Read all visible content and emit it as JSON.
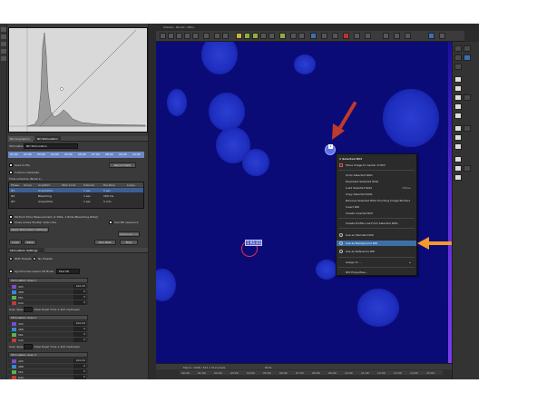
{
  "window": {
    "title": "Volume - Nuclei - NIS.s"
  },
  "left_panel": {
    "tabs": [
      "ND Acquisition",
      "ND Stimulation"
    ],
    "stimulation_label": "Stimulation",
    "stimulation_value": "ND Stimulation",
    "timeline_ticks": [
      "01:00",
      "02:00",
      "03:00",
      "04:00",
      "05:00",
      "06:00",
      "07:00",
      "08:00",
      "09:00",
      "10:00"
    ],
    "save_to_file": "Save to file",
    "record_data": "Record Data",
    "custom_metadata": "Custom metadata",
    "time_schedule": "Time schedule (Node 1)",
    "table_headers": [
      "Phase",
      "Group",
      "Acq/Stim",
      "Stim Cont.",
      "Interval",
      "Duration",
      "Loops"
    ],
    "table_rows": [
      [
        "#1",
        "Acquisition",
        "",
        "1 sec",
        "",
        "5 sec"
      ],
      [
        "#2",
        "Bleaching",
        "",
        "1 sec",
        "",
        "200 ms"
      ],
      [
        "#3",
        "Acquisition",
        "",
        "1 sec",
        "",
        "5 min"
      ]
    ],
    "perform_time_measurement": "Perform Time Measurement (1 ROIs, 1 ROIs (Bleaching ROIs))",
    "close_active_shutter": "Close Active Shutter when idle",
    "use_nd_sequence": "Use ND sequence",
    "apply_stimulation": "Apply Stimulation Settings",
    "advanced": "Advanced >>",
    "load": "Load",
    "save": "Save",
    "run_now": "Run Now",
    "stop": "Stop",
    "stimulation_settings": "Stimulation Settings",
    "with_presets": "With Presets",
    "no_presets": "No Presets",
    "synchronize_lasers": "Synchronize Lasers",
    "sp_mode": "SP Mode",
    "sp_mode_value": "Fast SD",
    "areas": [
      {
        "title": "Stimulation Area 1",
        "rows": [
          [
            "405",
            "100.00"
          ],
          [
            "488",
            "0"
          ],
          [
            "561",
            "0"
          ],
          [
            "640",
            "0"
          ]
        ],
        "scan_speed": "Scan Speed",
        "pixel_dwell": "Pixel Dwell Time 1.403 ms/lineLin"
      },
      {
        "title": "Stimulation Area 2",
        "rows": [
          [
            "405",
            "100.00"
          ],
          [
            "488",
            "0"
          ],
          [
            "561",
            "0"
          ],
          [
            "640",
            "0"
          ]
        ],
        "scan_speed": "Scan Speed",
        "pixel_dwell": "Pixel Dwell Time 1.403 ms/lineLin"
      },
      {
        "title": "Stimulation Area 3",
        "rows": [
          [
            "405",
            "100.00"
          ],
          [
            "488",
            "0"
          ],
          [
            "561",
            "0"
          ],
          [
            "640",
            "0"
          ]
        ],
        "scan_speed": "Scan Speed",
        "pixel_dwell": "Pixel Dwell Time 1.403 ms/lineLin"
      }
    ],
    "roi_approach": "Manual ROI Approach"
  },
  "canvas": {
    "roi_selected_label": "1",
    "roi_label": "1 R1 E1"
  },
  "context_menu": {
    "header": "1 Selected ROI",
    "items": [
      {
        "label": "Move Image to Center of ROI",
        "icon": "move-icon"
      },
      {
        "label": "Undo Selected ROIs",
        "icon": ""
      },
      {
        "label": "Duplicate Selected ROIs",
        "icon": ""
      },
      {
        "label": "Load Selected ROIs",
        "icon": "",
        "shortcut": "Ctrl+L"
      },
      {
        "label": "Copy Selected ROIs",
        "icon": ""
      },
      {
        "label": "Remove Selected ROIs Touching Image Borders",
        "icon": ""
      },
      {
        "label": "Invert ROI",
        "icon": ""
      },
      {
        "label": "Create Inverted ROI",
        "icon": ""
      },
      {
        "label": "Create Profile Line From Selected ROIs",
        "icon": ""
      },
      {
        "label": "Use as Standard ROI",
        "icon": "roi-standard-icon"
      },
      {
        "label": "Use as Background ROI",
        "icon": "roi-background-icon",
        "highlight": true
      },
      {
        "label": "Use as Reference ROI",
        "icon": "roi-reference-icon"
      },
      {
        "label": "Assign to ...",
        "icon": "",
        "submenu": true
      },
      {
        "label": "ROI Properties...",
        "icon": ""
      }
    ]
  },
  "bottom": {
    "info": "Macro: 1096 / 512 x 512 pixels",
    "scale": "Parfs",
    "timeline_labels": [
      "00:00",
      "01:00",
      "02:00",
      "03:00",
      "04:00",
      "05:00",
      "06:00",
      "07:00",
      "08:00",
      "09:00",
      "10:00",
      "11:00",
      "12:00",
      "13:00",
      "14:00",
      "15:00"
    ],
    "status": "0x1296 / 512 x 512 pixels"
  },
  "colors": {
    "canvas": "#0b0b78",
    "cell": "#1f2fc0",
    "arrow_red": "#c0392b",
    "arrow_orange": "#f39a2b",
    "menu_highlight": "#3e6ea8"
  }
}
